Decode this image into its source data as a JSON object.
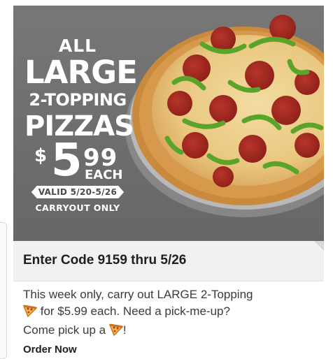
{
  "ad": {
    "hero": {
      "line1": "ALL",
      "line2": "LARGE",
      "line3": "2-TOPPING",
      "line4": "PIZZAS",
      "price_dollar": "$",
      "price_whole": "5",
      "price_cents": "99",
      "price_each": "EACH",
      "valid_label": "VALID 5/20-5/26",
      "carryout_label": "CARRYOUT ONLY"
    },
    "code_headline": "Enter Code 9159 thru 5/26",
    "description": {
      "part1": "This week only, carry out LARGE 2-Topping",
      "part2": "for $5.99 each. Need a pick-me-up?",
      "part3": "Come pick up a",
      "part4": "!",
      "icon": "pizza-slice-icon"
    },
    "cta": "Order Now"
  },
  "colors": {
    "hero_background": "#707070",
    "code_bar_background": "#f1f1f1",
    "text_dark": "#1f1f1f",
    "text_body": "#3a3a3a"
  }
}
